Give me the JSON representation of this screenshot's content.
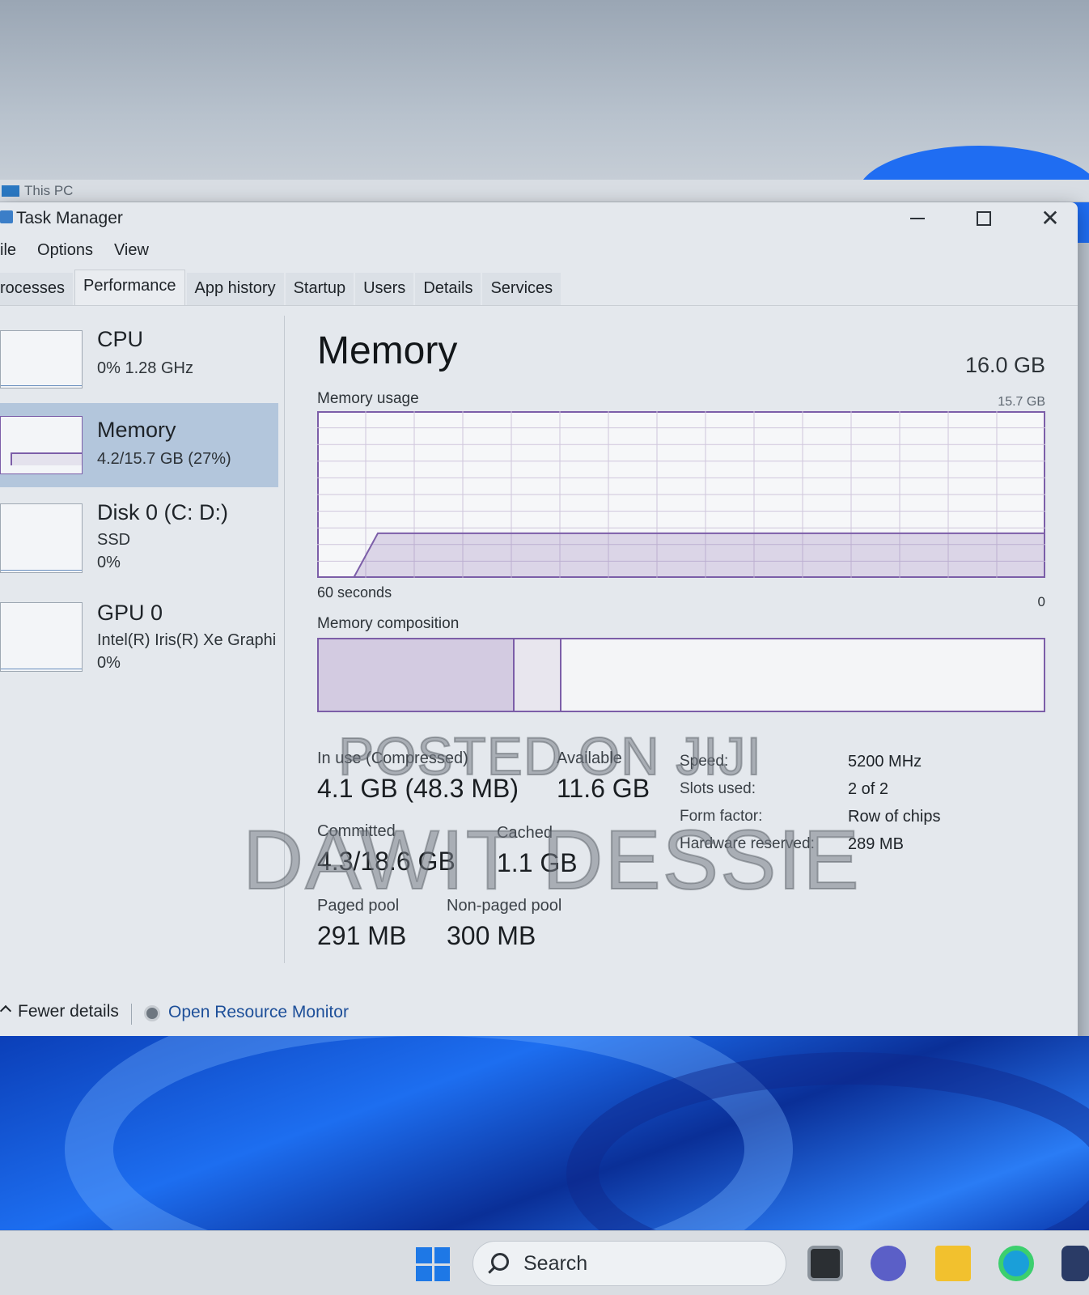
{
  "desktop": {
    "behind_window_title": "This PC"
  },
  "window": {
    "title": "Task Manager"
  },
  "menu": [
    "ile",
    "Options",
    "View"
  ],
  "tabs": [
    {
      "label": "rocesses",
      "active": false
    },
    {
      "label": "Performance",
      "active": true
    },
    {
      "label": "App history",
      "active": false
    },
    {
      "label": "Startup",
      "active": false
    },
    {
      "label": "Users",
      "active": false
    },
    {
      "label": "Details",
      "active": false
    },
    {
      "label": "Services",
      "active": false
    }
  ],
  "sidebar": {
    "items": [
      {
        "name": "CPU",
        "line1": "0%  1.28 GHz",
        "line2": "",
        "selected": false
      },
      {
        "name": "Memory",
        "line1": "4.2/15.7 GB (27%)",
        "line2": "",
        "selected": true
      },
      {
        "name": "Disk 0 (C: D:)",
        "line1": "SSD",
        "line2": "0%",
        "selected": false
      },
      {
        "name": "GPU 0",
        "line1": "Intel(R) Iris(R) Xe Graphi",
        "line2": "0%",
        "selected": false
      }
    ]
  },
  "main": {
    "title": "Memory",
    "total": "16.0 GB",
    "usage_label": "Memory usage",
    "usage_max": "15.7 GB",
    "axis_left": "60 seconds",
    "axis_right": "0",
    "composition_label": "Memory composition",
    "composition": {
      "in_use_fraction": 0.27,
      "modified_fraction": 0.065
    },
    "stats": {
      "in_use_label": "In use (Compressed)",
      "in_use_value": "4.1 GB (48.3 MB)",
      "available_label": "Available",
      "available_value": "11.6 GB",
      "committed_label": "Committed",
      "committed_value": "4.3/18.6 GB",
      "cached_label": "Cached",
      "cached_value": "1.1 GB",
      "paged_label": "Paged pool",
      "paged_value": "291 MB",
      "nonpaged_label": "Non-paged pool",
      "nonpaged_value": "300 MB"
    },
    "info": {
      "speed_label": "Speed:",
      "speed_value": "5200 MHz",
      "slots_label": "Slots used:",
      "slots_value": "2 of 2",
      "form_label": "Form factor:",
      "form_value": "Row of chips",
      "hw_label": "Hardware reserved:",
      "hw_value": "289 MB"
    }
  },
  "footer": {
    "fewer_details": "Fewer details",
    "resource_monitor": "Open Resource Monitor"
  },
  "taskbar": {
    "search_placeholder": "Search"
  },
  "watermark": {
    "line1": "POSTED ON JIJI",
    "line2": "DAWIT DESSIE"
  },
  "chart_data": {
    "type": "area",
    "x_label_left": "60 seconds",
    "x_label_right": "0",
    "ylim": [
      0,
      15.7
    ],
    "x": [
      60,
      57,
      55,
      0
    ],
    "values": [
      0,
      0,
      4.2,
      4.2
    ],
    "grid": true,
    "color": "#7c5ea8"
  },
  "colors": {
    "accent": "#7c5ea8",
    "selected": "#b3c6dc",
    "windows_blue": "#1e78e6"
  }
}
